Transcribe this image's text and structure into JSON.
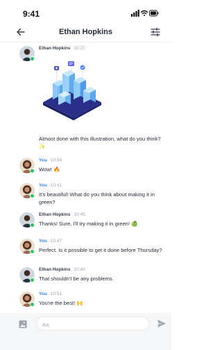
{
  "status_bar": {
    "time": "9:41"
  },
  "header": {
    "title": "Ethan Hopkins"
  },
  "messages": [
    {
      "sender": "Ethan Hopkins",
      "time": "10:27",
      "text": "Almost done with this illustration, what do you think? ✨"
    },
    {
      "sender": "You",
      "time": "10:34",
      "text": "Wow! 🔥"
    },
    {
      "sender": "You",
      "time": "10:41",
      "text": "It's beautiful! What do you think about making it in green?"
    },
    {
      "sender": "Ethan Hopkins",
      "time": "10:45",
      "text": "Thanks! Sure, I'll try making it in green! 🍏"
    },
    {
      "sender": "You",
      "time": "10:47",
      "text": "Perfect. Is it possible to get it done before Thursday?"
    },
    {
      "sender": "Ethan Hopkins",
      "time": "10:49",
      "text": "That shouldn't be any problems."
    },
    {
      "sender": "You",
      "time": "10:51",
      "text": "You're the best! 🙌"
    }
  ],
  "composer": {
    "placeholder": "Aa"
  },
  "icons": {
    "back": "arrow-left-icon",
    "filter": "sliders-icon",
    "image": "image-icon",
    "send": "send-icon"
  },
  "colors": {
    "accent": "#3b82f6",
    "online": "#22c55e",
    "composer_bg": "#f5f6f8"
  }
}
